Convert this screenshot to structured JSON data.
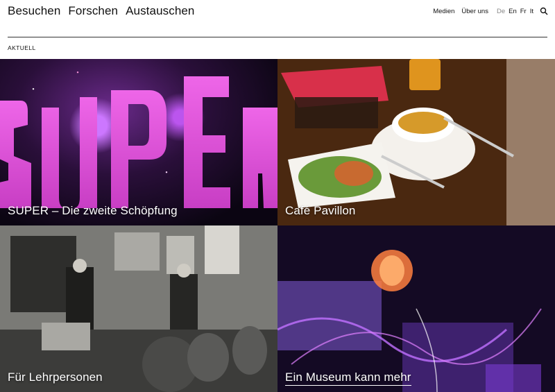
{
  "nav": {
    "items": [
      {
        "label": "Besuchen"
      },
      {
        "label": "Forschen"
      },
      {
        "label": "Austauschen"
      }
    ]
  },
  "utility": {
    "media": "Medien",
    "about": "Über uns",
    "languages": [
      {
        "code": "De",
        "active": true
      },
      {
        "code": "En",
        "active": false
      },
      {
        "code": "Fr",
        "active": false
      },
      {
        "code": "It",
        "active": false
      }
    ],
    "search_icon": "search-icon"
  },
  "section": {
    "label": "AKTUELL"
  },
  "tiles": [
    {
      "title": "SUPER – Die zweite Schöpfung",
      "image_text": "SUPER"
    },
    {
      "title": "Café Pavillon"
    },
    {
      "title": "Für Lehrpersonen"
    },
    {
      "title": "Ein Museum kann mehr"
    }
  ],
  "colors": {
    "accent_pink": "#e45ce0",
    "text": "#111111"
  }
}
